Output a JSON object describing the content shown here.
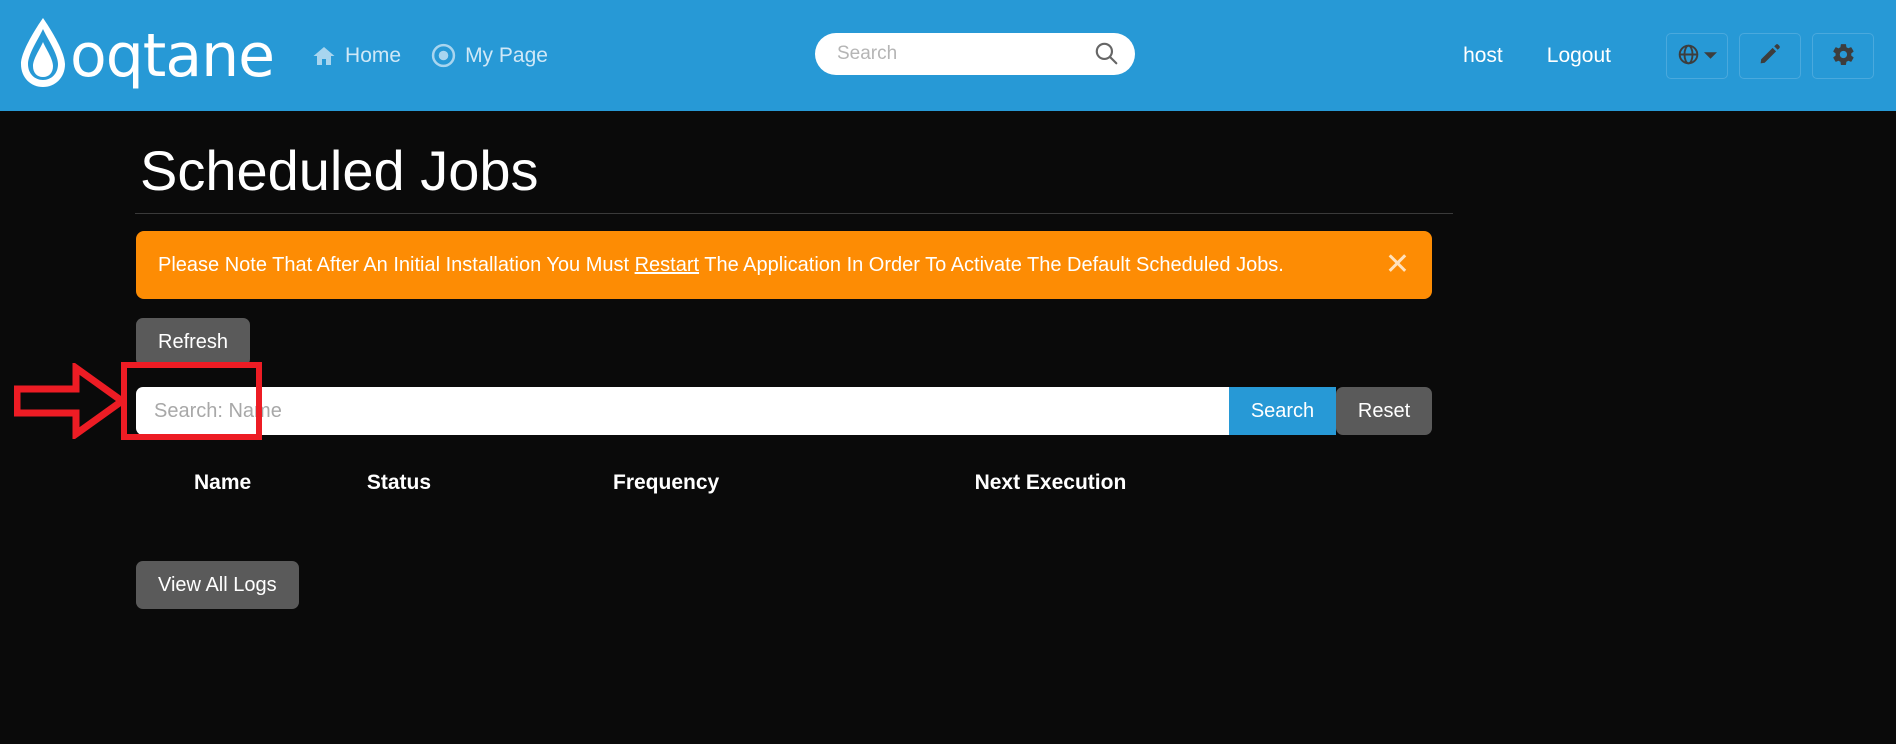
{
  "colors": {
    "header_blue": "#2799d6",
    "alert_orange": "#fd8c04",
    "page_background": "#0a0a0a",
    "button_secondary": "#5a5a5a",
    "annotation_red": "#ed1c24"
  },
  "header": {
    "brand": "oqtane",
    "brand_icon": "water-drop-icon",
    "nav": [
      {
        "label": "Home",
        "icon": "home-icon"
      },
      {
        "label": "My Page",
        "icon": "target-icon"
      }
    ],
    "search": {
      "placeholder": "Search",
      "value": "",
      "icon": "search-icon"
    },
    "user": "host",
    "logout": "Logout",
    "icon_buttons": [
      {
        "name": "language-selector",
        "icon": "globe-icon",
        "has_chevron": true
      },
      {
        "name": "edit-mode",
        "icon": "pencil-icon",
        "has_chevron": false
      },
      {
        "name": "site-settings",
        "icon": "gear-icon",
        "has_chevron": false
      }
    ]
  },
  "page": {
    "title": "Scheduled Jobs"
  },
  "alert": {
    "text_before": "Please Note That After An Initial Installation You Must ",
    "link": "Restart",
    "text_after": " The Application In Order To Activate The Default Scheduled Jobs.",
    "close_icon": "close-icon"
  },
  "toolbar": {
    "refresh_label": "Refresh"
  },
  "filter": {
    "placeholder": "Search: Name",
    "value": "",
    "search_label": "Search",
    "reset_label": "Reset"
  },
  "table": {
    "columns": [
      "Name",
      "Status",
      "Frequency",
      "Next Execution"
    ],
    "rows": []
  },
  "footer": {
    "view_logs_label": "View All Logs"
  },
  "annotation": {
    "type": "red-arrow-highlight",
    "target": "refresh-button"
  }
}
